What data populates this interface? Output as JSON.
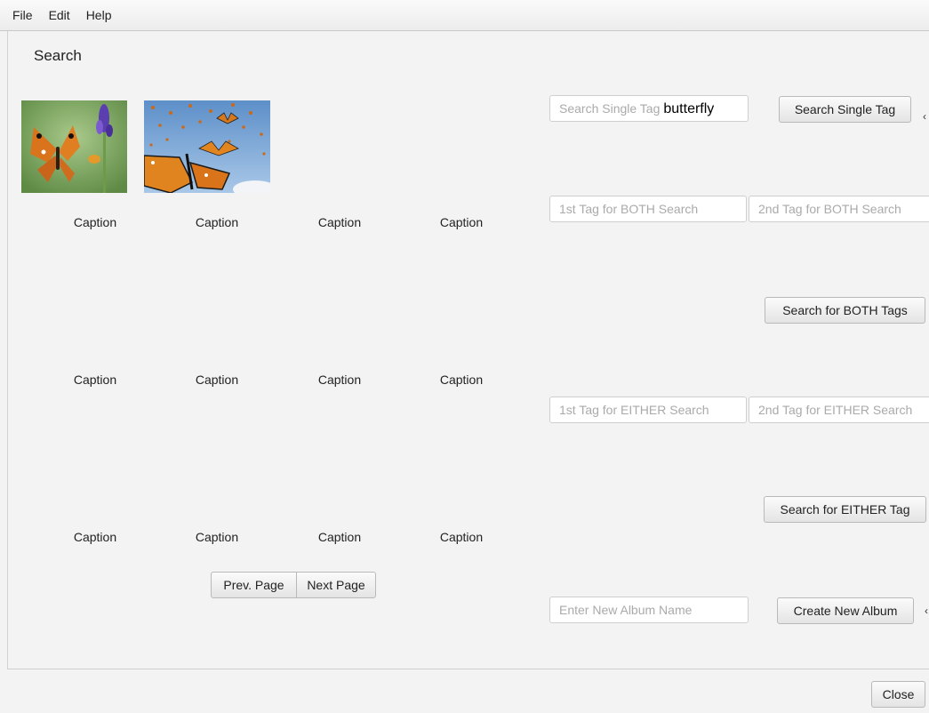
{
  "menu": {
    "file": "File",
    "edit": "Edit",
    "help": "Help"
  },
  "page": {
    "title": "Search"
  },
  "thumbnails": [
    {
      "icon": "butterfly-photo-1"
    },
    {
      "icon": "butterfly-photo-2"
    }
  ],
  "captions": {
    "row1": [
      "Caption",
      "Caption",
      "Caption",
      "Caption"
    ],
    "row2": [
      "Caption",
      "Caption",
      "Caption",
      "Caption"
    ],
    "row3": [
      "Caption",
      "Caption",
      "Caption",
      "Caption"
    ]
  },
  "pagination": {
    "prev": "Prev. Page",
    "next": "Next Page"
  },
  "single_search": {
    "placeholder": "Search Single Tag",
    "value": "butterfly",
    "button": "Search Single Tag"
  },
  "both_search": {
    "tag1_placeholder": "1st Tag for BOTH Search",
    "tag2_placeholder": "2nd Tag for BOTH Search",
    "button": "Search for BOTH Tags"
  },
  "either_search": {
    "tag1_placeholder": "1st Tag for EITHER Search",
    "tag2_placeholder": "2nd Tag for EITHER Search",
    "button": "Search for EITHER Tag"
  },
  "album": {
    "placeholder": "Enter New Album Name",
    "button": "Create New Album"
  },
  "footer": {
    "close": "Close"
  },
  "colors": {
    "background": "#f3f3f3",
    "field_placeholder": "#aaaaaa",
    "button_border": "#b9b9b9"
  }
}
